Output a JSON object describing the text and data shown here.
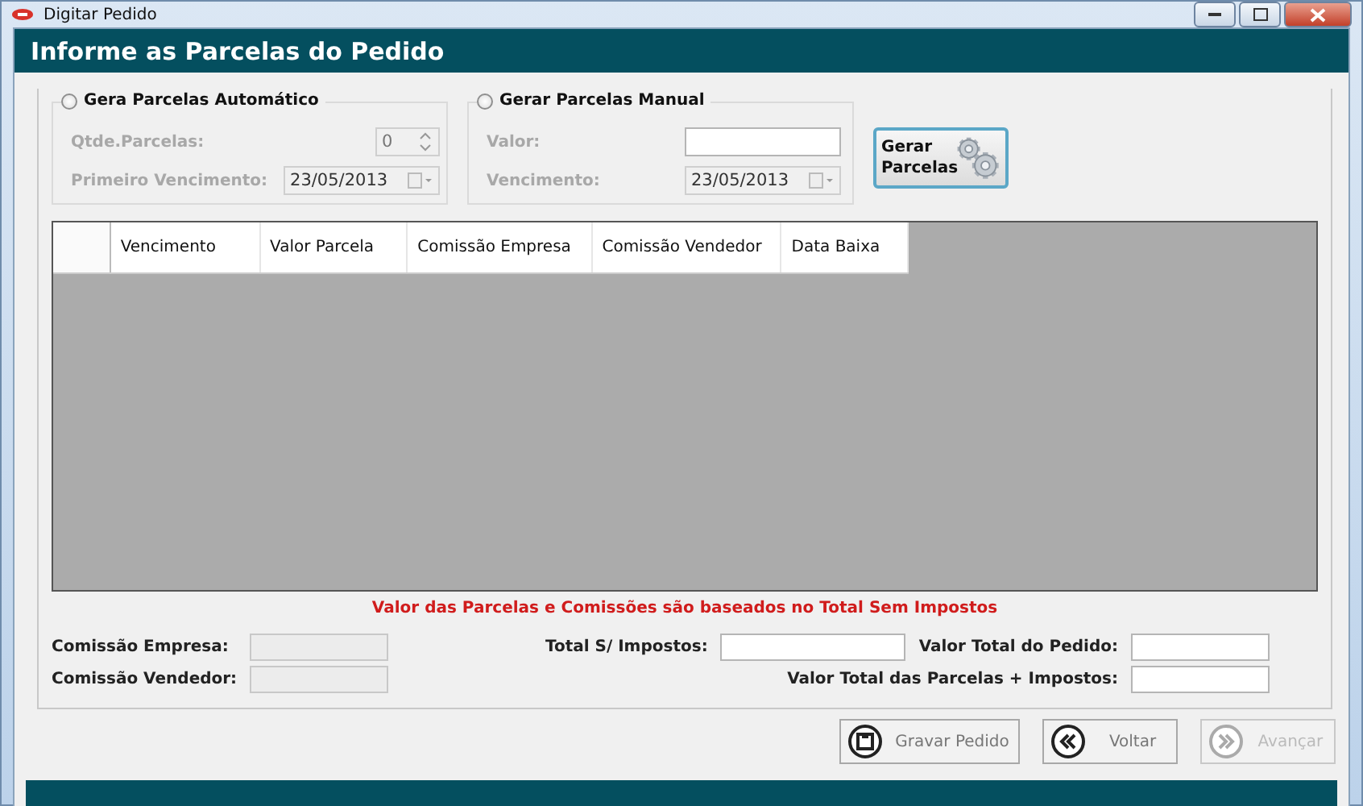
{
  "window": {
    "title": "Digitar Pedido"
  },
  "header": {
    "title": "Informe as Parcelas do Pedido"
  },
  "auto_group": {
    "label": "Gera Parcelas Automático",
    "selected": false,
    "qty_label": "Qtde.Parcelas:",
    "qty_value": "0",
    "date_label": "Primeiro Vencimento:",
    "date_value": "23/05/2013"
  },
  "manual_group": {
    "label": "Gerar Parcelas Manual",
    "selected": false,
    "value_label": "Valor:",
    "date_label": "Vencimento:",
    "date_value": "23/05/2013"
  },
  "generate_button": {
    "label": "Gerar Parcelas"
  },
  "table": {
    "columns": [
      "Vencimento",
      "Valor Parcela",
      "Comissão Empresa",
      "Comissão Vendedor",
      "Data Baixa"
    ]
  },
  "note": "Valor das Parcelas e Comissões são baseados no Total Sem Impostos",
  "totals_left": [
    {
      "label": "Comissão Empresa:",
      "disabled": true
    },
    {
      "label": "Comissão Vendedor:",
      "disabled": true
    }
  ],
  "totals_right": [
    {
      "label": "Total S/ Impostos:",
      "disabled": false
    },
    {
      "label": "Valor Total do Pedido:",
      "disabled": false
    },
    {
      "label": "Valor Total das Parcelas + Impostos:",
      "disabled": false
    }
  ],
  "buttons": [
    {
      "label": "Gravar Pedido",
      "kind": "save",
      "disabled": false
    },
    {
      "label": "Voltar",
      "kind": "back",
      "disabled": false
    },
    {
      "label": "Avançar",
      "kind": "forward",
      "disabled": true
    }
  ]
}
